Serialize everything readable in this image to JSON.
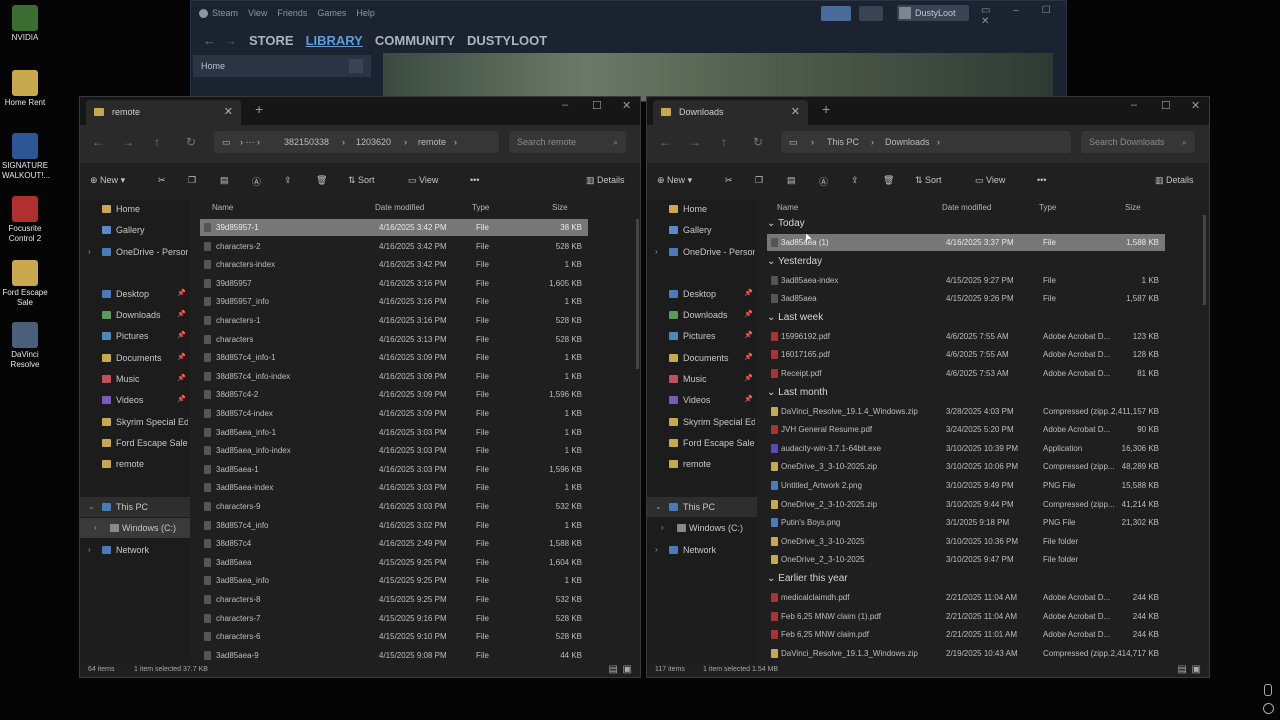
{
  "desktop": {
    "icons": [
      {
        "label": "NVIDIA",
        "color": "#3b6e2e"
      },
      {
        "label": "Home Rent",
        "color": "#c9a94e"
      },
      {
        "label": "SIGNATURE WALKOUT!...",
        "color": "#2b5797"
      },
      {
        "label": "Focusrite Control 2",
        "color": "#b03030"
      },
      {
        "label": "Ford Escape Sale",
        "color": "#c9a94e"
      },
      {
        "label": "DaVinci Resolve",
        "color": "#4a5f7a"
      }
    ]
  },
  "steam": {
    "menu": [
      "Steam",
      "View",
      "Friends",
      "Games",
      "Help"
    ],
    "nav": [
      "STORE",
      "LIBRARY",
      "COMMUNITY",
      "DUSTYLOOT"
    ],
    "username": "DustyLoot",
    "home": "Home"
  },
  "left": {
    "tab": "remote",
    "path": [
      "382150338",
      "1203620",
      "remote"
    ],
    "search_placeholder": "Search remote",
    "cmd": {
      "new": "New",
      "sort": "Sort",
      "view": "View",
      "details": "Details"
    },
    "nav": [
      "Home",
      "Gallery",
      "OneDrive - Personal",
      "Desktop",
      "Downloads",
      "Pictures",
      "Documents",
      "Music",
      "Videos",
      "Skyrim Special Edition",
      "Ford Escape Sale",
      "remote",
      "This PC",
      "Windows (C:)",
      "Network"
    ],
    "columns": [
      "Name",
      "Date modified",
      "Type",
      "Size"
    ],
    "files": [
      [
        "39d85957-1",
        "4/16/2025 3:42 PM",
        "File",
        "38 KB"
      ],
      [
        "characters-2",
        "4/16/2025 3:42 PM",
        "File",
        "528 KB"
      ],
      [
        "characters-index",
        "4/16/2025 3:42 PM",
        "File",
        "1 KB"
      ],
      [
        "39d85957",
        "4/16/2025 3:16 PM",
        "File",
        "1,605 KB"
      ],
      [
        "39d85957_info",
        "4/16/2025 3:16 PM",
        "File",
        "1 KB"
      ],
      [
        "characters-1",
        "4/16/2025 3:16 PM",
        "File",
        "528 KB"
      ],
      [
        "characters",
        "4/16/2025 3:13 PM",
        "File",
        "528 KB"
      ],
      [
        "38d857c4_info-1",
        "4/16/2025 3:09 PM",
        "File",
        "1 KB"
      ],
      [
        "38d857c4_info-index",
        "4/16/2025 3:09 PM",
        "File",
        "1 KB"
      ],
      [
        "38d857c4-2",
        "4/16/2025 3:09 PM",
        "File",
        "1,596 KB"
      ],
      [
        "38d857c4-index",
        "4/16/2025 3:09 PM",
        "File",
        "1 KB"
      ],
      [
        "3ad85aea_info-1",
        "4/16/2025 3:03 PM",
        "File",
        "1 KB"
      ],
      [
        "3ad85aea_info-index",
        "4/16/2025 3:03 PM",
        "File",
        "1 KB"
      ],
      [
        "3ad85aea-1",
        "4/16/2025 3:03 PM",
        "File",
        "1,596 KB"
      ],
      [
        "3ad85aea-index",
        "4/16/2025 3:03 PM",
        "File",
        "1 KB"
      ],
      [
        "characters-9",
        "4/16/2025 3:03 PM",
        "File",
        "532 KB"
      ],
      [
        "38d857c4_info",
        "4/16/2025 3:02 PM",
        "File",
        "1 KB"
      ],
      [
        "38d857c4",
        "4/16/2025 2:49 PM",
        "File",
        "1,588 KB"
      ],
      [
        "3ad85aea",
        "4/15/2025 9:25 PM",
        "File",
        "1,604 KB"
      ],
      [
        "3ad85aea_info",
        "4/15/2025 9:25 PM",
        "File",
        "1 KB"
      ],
      [
        "characters-8",
        "4/15/2025 9:25 PM",
        "File",
        "532 KB"
      ],
      [
        "characters-7",
        "4/15/2025 9:16 PM",
        "File",
        "528 KB"
      ],
      [
        "characters-6",
        "4/15/2025 9:10 PM",
        "File",
        "528 KB"
      ],
      [
        "3ad85aea-9",
        "4/15/2025 9:08 PM",
        "File",
        "44 KB"
      ]
    ],
    "status": {
      "items": "64 items",
      "selected": "1 item selected  37.7 KB"
    }
  },
  "right": {
    "tab": "Downloads",
    "path": [
      "This PC",
      "Downloads"
    ],
    "search_placeholder": "Search Downloads",
    "cmd": {
      "new": "New",
      "sort": "Sort",
      "view": "View",
      "details": "Details"
    },
    "nav": [
      "Home",
      "Gallery",
      "OneDrive - Personal",
      "Desktop",
      "Downloads",
      "Pictures",
      "Documents",
      "Music",
      "Videos",
      "Skyrim Special Edition",
      "Ford Escape Sale",
      "remote",
      "This PC",
      "Windows (C:)",
      "Network"
    ],
    "columns": [
      "Name",
      "Date modified",
      "Type",
      "Size"
    ],
    "groups": [
      {
        "title": "Today",
        "files": [
          [
            "3ad85aea (1)",
            "4/16/2025 3:37 PM",
            "File",
            "1,588 KB"
          ]
        ]
      },
      {
        "title": "Yesterday",
        "files": [
          [
            "3ad85aea-index",
            "4/15/2025 9:27 PM",
            "File",
            "1 KB"
          ],
          [
            "3ad85aea",
            "4/15/2025 9:26 PM",
            "File",
            "1,587 KB"
          ]
        ]
      },
      {
        "title": "Last week",
        "files": [
          [
            "15996192.pdf",
            "4/6/2025 7:55 AM",
            "Adobe Acrobat D...",
            "123 KB"
          ],
          [
            "16017165.pdf",
            "4/6/2025 7:55 AM",
            "Adobe Acrobat D...",
            "128 KB"
          ],
          [
            "Receipt.pdf",
            "4/6/2025 7:53 AM",
            "Adobe Acrobat D...",
            "81 KB"
          ]
        ]
      },
      {
        "title": "Last month",
        "files": [
          [
            "DaVinci_Resolve_19.1.4_Windows.zip",
            "3/28/2025 4:03 PM",
            "Compressed (zipp...",
            "2,411,157 KB"
          ],
          [
            "JVH General Resume.pdf",
            "3/24/2025 5:20 PM",
            "Adobe Acrobat D...",
            "90 KB"
          ],
          [
            "audacity-win-3.7.1-64bit.exe",
            "3/10/2025 10:39 PM",
            "Application",
            "16,306 KB"
          ],
          [
            "OneDrive_3_3-10-2025.zip",
            "3/10/2025 10:06 PM",
            "Compressed (zipp...",
            "48,289 KB"
          ],
          [
            "Untitled_Artwork 2.png",
            "3/10/2025 9:49 PM",
            "PNG File",
            "15,588 KB"
          ],
          [
            "OneDrive_2_3-10-2025.zip",
            "3/10/2025 9:44 PM",
            "Compressed (zipp...",
            "41,214 KB"
          ],
          [
            "Putin's Boys.png",
            "3/1/2025 9:18 PM",
            "PNG File",
            "21,302 KB"
          ],
          [
            "OneDrive_3_3-10-2025",
            "3/10/2025 10:36 PM",
            "File folder",
            ""
          ],
          [
            "OneDrive_2_3-10-2025",
            "3/10/2025 9:47 PM",
            "File folder",
            ""
          ]
        ]
      },
      {
        "title": "Earlier this year",
        "files": [
          [
            "medicalclaimdh.pdf",
            "2/21/2025 11:04 AM",
            "Adobe Acrobat D...",
            "244 KB"
          ],
          [
            "Feb 6,25 MNW claim (1).pdf",
            "2/21/2025 11:04 AM",
            "Adobe Acrobat D...",
            "244 KB"
          ],
          [
            "Feb 6,25 MNW claim.pdf",
            "2/21/2025 11:01 AM",
            "Adobe Acrobat D...",
            "244 KB"
          ],
          [
            "DaVinci_Resolve_19.1.3_Windows.zip",
            "2/19/2025 10:43 AM",
            "Compressed (zipp...",
            "2,414,717 KB"
          ]
        ]
      }
    ],
    "status": {
      "items": "117 items",
      "selected": "1 item selected  1.54 MB"
    }
  }
}
